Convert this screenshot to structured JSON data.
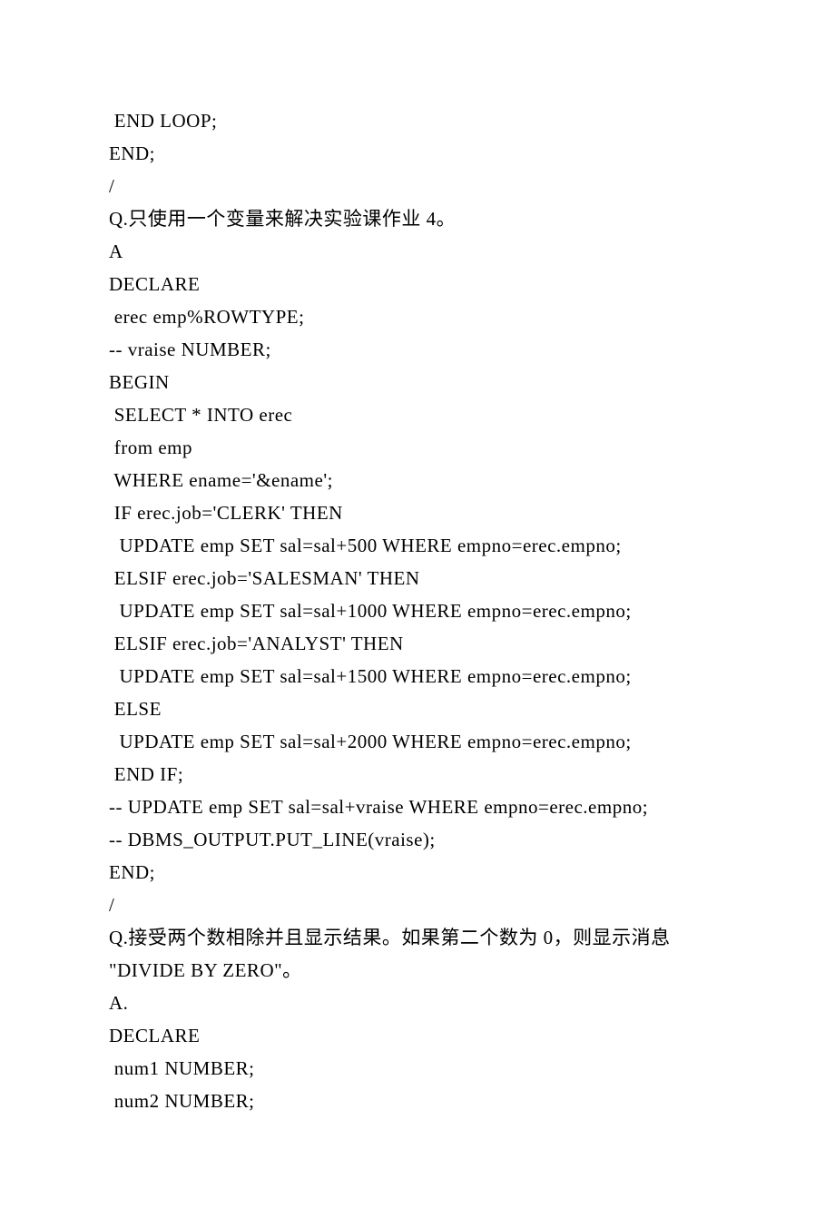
{
  "lines": [
    {
      "text": " END LOOP;",
      "indent": 0
    },
    {
      "text": "END;",
      "indent": 0
    },
    {
      "text": "/",
      "indent": 0
    },
    {
      "text": "Q.只使用一个变量来解决实验课作业 4。",
      "indent": 0
    },
    {
      "text": "A",
      "indent": 0
    },
    {
      "text": "DECLARE",
      "indent": 0
    },
    {
      "text": " erec emp%ROWTYPE;",
      "indent": 0
    },
    {
      "text": "-- vraise NUMBER;",
      "indent": 0
    },
    {
      "text": "BEGIN",
      "indent": 0
    },
    {
      "text": " SELECT * INTO erec",
      "indent": 0
    },
    {
      "text": " from emp",
      "indent": 0
    },
    {
      "text": " WHERE ename='&ename';",
      "indent": 0
    },
    {
      "text": " IF erec.job='CLERK' THEN",
      "indent": 0
    },
    {
      "text": "  UPDATE emp SET sal=sal+500 WHERE empno=erec.empno;",
      "indent": 0
    },
    {
      "text": " ELSIF erec.job='SALESMAN' THEN",
      "indent": 0
    },
    {
      "text": "  UPDATE emp SET sal=sal+1000 WHERE empno=erec.empno;",
      "indent": 0
    },
    {
      "text": " ELSIF erec.job='ANALYST' THEN",
      "indent": 0
    },
    {
      "text": "  UPDATE emp SET sal=sal+1500 WHERE empno=erec.empno;",
      "indent": 0
    },
    {
      "text": " ELSE",
      "indent": 0
    },
    {
      "text": "  UPDATE emp SET sal=sal+2000 WHERE empno=erec.empno;",
      "indent": 0
    },
    {
      "text": " END IF;",
      "indent": 0
    },
    {
      "text": "-- UPDATE emp SET sal=sal+vraise WHERE empno=erec.empno;",
      "indent": 0
    },
    {
      "text": "-- DBMS_OUTPUT.PUT_LINE(vraise);",
      "indent": 0
    },
    {
      "text": "END;",
      "indent": 0
    },
    {
      "text": "/",
      "indent": 0
    },
    {
      "text": "Q.接受两个数相除并且显示结果。如果第二个数为 0，则显示消息",
      "indent": 0
    },
    {
      "text": "\"DIVIDE BY ZERO\"。",
      "indent": 0
    },
    {
      "text": "A.",
      "indent": 0
    },
    {
      "text": "DECLARE",
      "indent": 0
    },
    {
      "text": " num1 NUMBER;",
      "indent": 0
    },
    {
      "text": " num2 NUMBER;",
      "indent": 0
    }
  ]
}
